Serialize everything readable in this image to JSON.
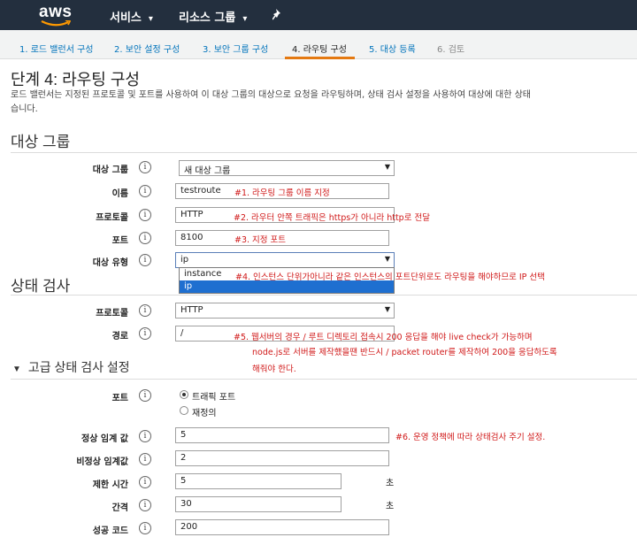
{
  "nav": {
    "logo": "aws",
    "services": "서비스",
    "resource_groups": "리소스 그룹",
    "chevron": "▾",
    "pin_icon": "pin-icon"
  },
  "steps": [
    {
      "label": "1. 로드 밸런서 구성"
    },
    {
      "label": "2. 보안 설정 구성"
    },
    {
      "label": "3. 보안 그룹 구성"
    },
    {
      "label": "4. 라우팅 구성"
    },
    {
      "label": "5. 대상 등록"
    },
    {
      "label": "6. 검토"
    }
  ],
  "page": {
    "title": "단계 4: 라우팅 구성",
    "description_line1": "로드 밸런서는 지정된 프로토콜 및 포트를 사용하여 이 대상 그룹의 대상으로 요청을 라우팅하며, 상태 검사 설정을 사용하여 대상에 대한 상태",
    "description_line2": "습니다."
  },
  "target_group": {
    "heading": "대상 그룹",
    "target_group_label": "대상 그룹",
    "target_group_value": "새 대상 그룹",
    "name_label": "이름",
    "name_value": "testroute",
    "name_note": "#1. 라우팅 그룹 이름 지정",
    "protocol_label": "프로토콜",
    "protocol_value": "HTTP",
    "protocol_note": "#2. 라우터 안쪽 트래픽은 https가 아니라 http로 전달",
    "port_label": "포트",
    "port_value": "8100",
    "port_note": "#3. 지정 포트",
    "target_type_label": "대상 유형",
    "target_type_value": "ip",
    "target_type_options": [
      "instance",
      "ip"
    ],
    "target_type_note": "#4. 인스턴스 단위가아니라 같은 인스턴스의 포트단위로도 라우팅을 해야하므로 IP 선택"
  },
  "health_check": {
    "heading": "상태 검사",
    "protocol_label": "프로토콜",
    "protocol_value": "HTTP",
    "path_label": "경로",
    "path_value": "/",
    "path_note_line1": "#5. 웹서버의 경우 / 루트 디렉토리 접속시 200 응답을 해야 live check가 가능하며",
    "path_note_line2": "node.js로 서버를 제작했을땐 반드시 / packet router를 제작하여 200을 응답하도록",
    "path_note_line3": "해줘야 한다."
  },
  "advanced": {
    "heading": "고급 상태 검사 설정",
    "port_label": "포트",
    "radio_traffic": "트래픽 포트",
    "radio_override": "재정의",
    "healthy_label": "정상 임계 값",
    "healthy_value": "5",
    "healthy_note": "#6. 운영 정책에 따라 상태검사 주기 설정.",
    "unhealthy_label": "비정상 임계값",
    "unhealthy_value": "2",
    "timeout_label": "제한 시간",
    "timeout_value": "5",
    "timeout_unit": "초",
    "interval_label": "간격",
    "interval_value": "30",
    "interval_unit": "초",
    "success_label": "성공 코드",
    "success_value": "200"
  },
  "info_icon": "i",
  "caret": "▼"
}
